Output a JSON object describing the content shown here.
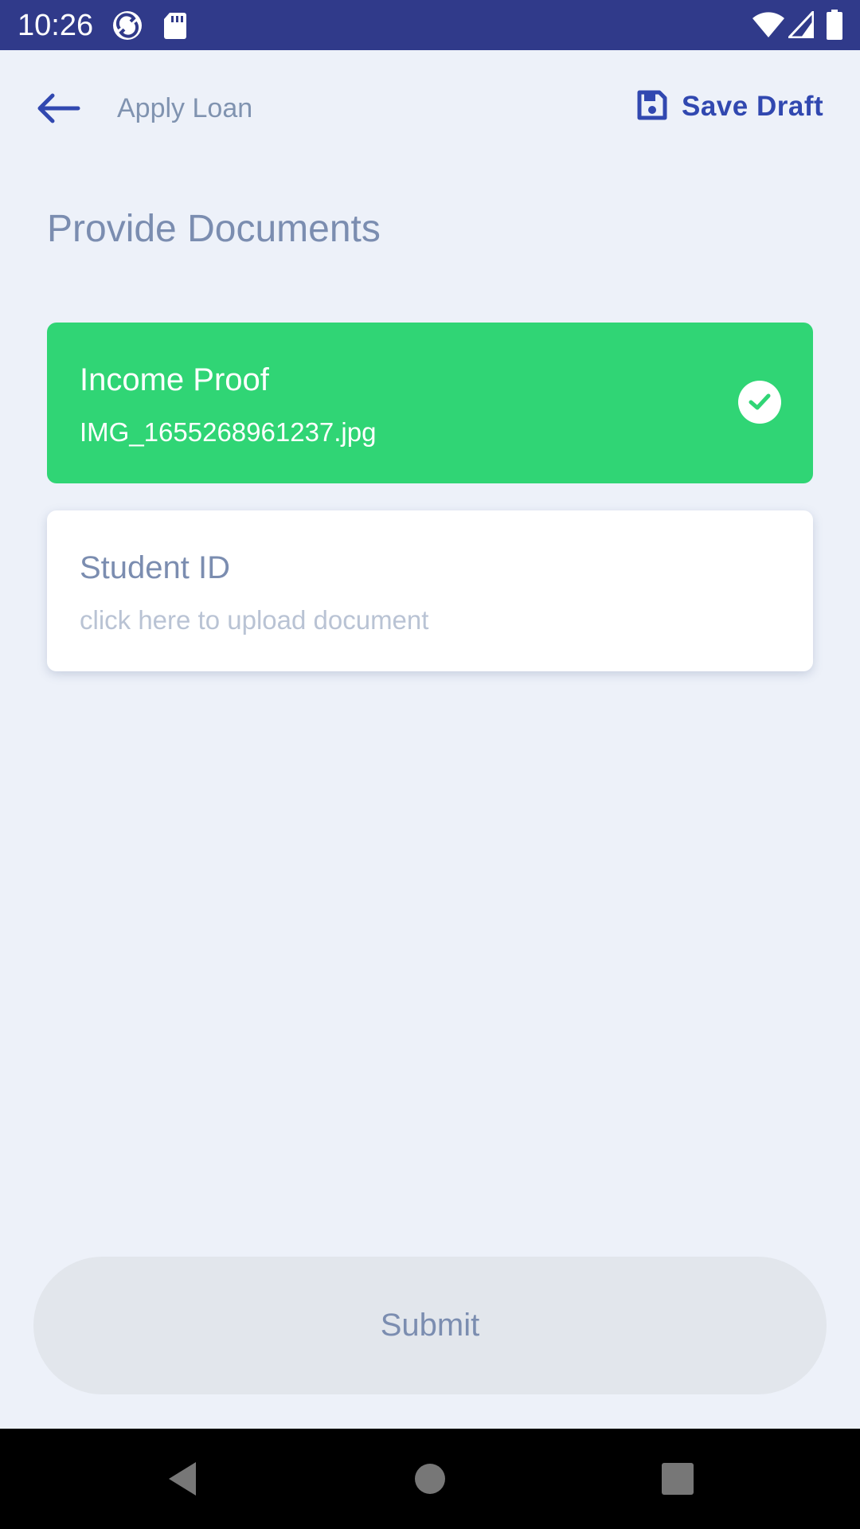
{
  "status_bar": {
    "time": "10:26",
    "icons": [
      "sync-app-icon",
      "sd-card-icon",
      "wifi-icon",
      "cell-signal-icon",
      "battery-icon"
    ]
  },
  "app_bar": {
    "back_icon": "arrow-left-icon",
    "title": "Apply Loan",
    "save_icon": "floppy-disk-icon",
    "save_label": "Save Draft"
  },
  "page": {
    "title": "Provide Documents"
  },
  "documents": [
    {
      "title": "Income Proof",
      "subtitle": "IMG_1655268961237.jpg",
      "status": "uploaded",
      "status_icon": "check-circle-icon"
    },
    {
      "title": "Student ID",
      "subtitle": "click here to upload document",
      "status": "pending"
    }
  ],
  "submit": {
    "label": "Submit"
  },
  "nav_bar": {
    "icons": [
      "back-triangle-icon",
      "home-circle-icon",
      "recents-square-icon"
    ]
  },
  "colors": {
    "status_bar": "#303a8a",
    "accent": "#3148b0",
    "success": "#30d575",
    "background": "#edf1f9",
    "muted_text": "#7b8db0"
  }
}
